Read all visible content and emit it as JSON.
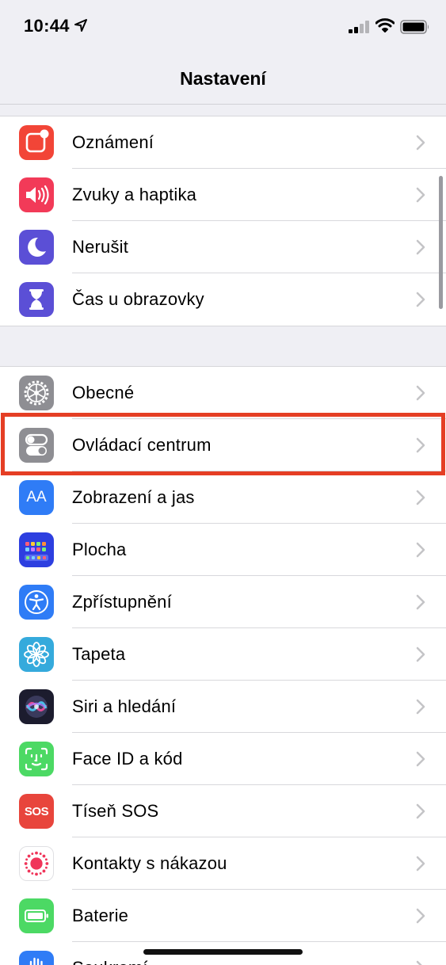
{
  "status_bar": {
    "time": "10:44"
  },
  "nav": {
    "title": "Nastavení"
  },
  "groups": [
    {
      "rows": [
        {
          "label": "Oznámení",
          "icon": "notifications-icon",
          "color": "#f24537"
        },
        {
          "label": "Zvuky a haptika",
          "icon": "sounds-icon",
          "color": "#f23a58"
        },
        {
          "label": "Nerušit",
          "icon": "moon-icon",
          "color": "#5b4fd6"
        },
        {
          "label": "Čas u obrazovky",
          "icon": "hourglass-icon",
          "color": "#5b4fd6"
        }
      ]
    },
    {
      "rows": [
        {
          "label": "Obecné",
          "icon": "gear-icon",
          "color": "#8e8e93"
        },
        {
          "label": "Ovládací centrum",
          "icon": "switches-icon",
          "color": "#8e8e93"
        },
        {
          "label": "Zobrazení a jas",
          "icon": "text-size-icon",
          "color": "#2f7cf6",
          "glyph": "AA"
        },
        {
          "label": "Plocha",
          "icon": "home-screen-icon",
          "color": "#2d3fe0"
        },
        {
          "label": "Zpřístupnění",
          "icon": "accessibility-icon",
          "color": "#2f7cf6"
        },
        {
          "label": "Tapeta",
          "icon": "flower-icon",
          "color": "#35aadc"
        },
        {
          "label": "Siri a hledání",
          "icon": "siri-icon",
          "color": "#1c1c2e"
        },
        {
          "label": "Face ID a kód",
          "icon": "face-id-icon",
          "color": "#4cd964"
        },
        {
          "label": "Tíseň SOS",
          "icon": "sos-icon",
          "color": "#e8453c",
          "glyph": "SOS"
        },
        {
          "label": "Kontakty s nákazou",
          "icon": "exposure-icon",
          "color": "#ffffff"
        },
        {
          "label": "Baterie",
          "icon": "battery-icon",
          "color": "#4cd964"
        },
        {
          "label": "Soukromí",
          "icon": "privacy-hand-icon",
          "color": "#2f7cf6"
        }
      ]
    }
  ],
  "highlight_color": "#e53e24"
}
